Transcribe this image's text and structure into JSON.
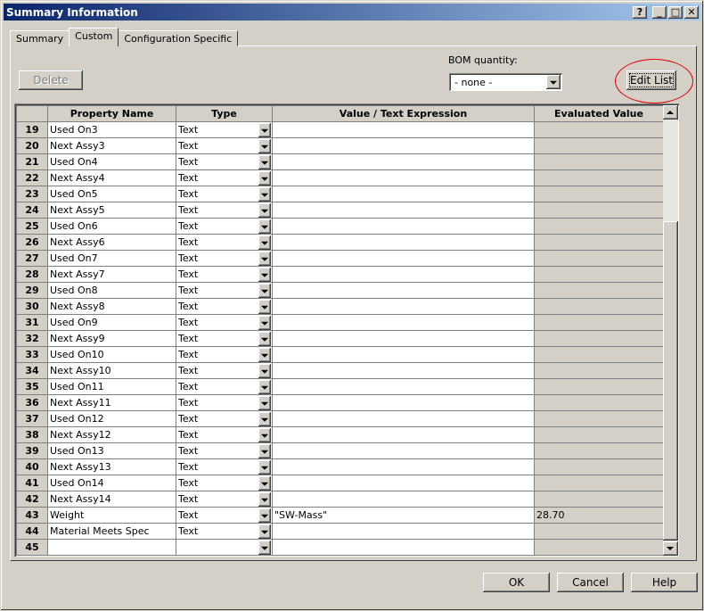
{
  "window": {
    "title": "Summary Information",
    "controls": [
      "?",
      "_",
      "□",
      "✕"
    ]
  },
  "tabs": [
    {
      "label": "Summary"
    },
    {
      "label": "Custom"
    },
    {
      "label": "Configuration Specific"
    }
  ],
  "toolbar": {
    "delete_label": "Delete",
    "bom_label": "BOM quantity:",
    "bom_value": "- none -",
    "edit_list_label": "Edit List"
  },
  "grid": {
    "headers": {
      "corner": "",
      "name": "Property Name",
      "type": "Type",
      "value": "Value / Text Expression",
      "evaluated": "Evaluated Value"
    },
    "rows": [
      {
        "num": "19",
        "name": "Used On3",
        "type": "Text",
        "value": "",
        "eval": ""
      },
      {
        "num": "20",
        "name": "Next Assy3",
        "type": "Text",
        "value": "",
        "eval": ""
      },
      {
        "num": "21",
        "name": "Used On4",
        "type": "Text",
        "value": "",
        "eval": ""
      },
      {
        "num": "22",
        "name": "Next Assy4",
        "type": "Text",
        "value": "",
        "eval": ""
      },
      {
        "num": "23",
        "name": "Used On5",
        "type": "Text",
        "value": "",
        "eval": ""
      },
      {
        "num": "24",
        "name": "Next Assy5",
        "type": "Text",
        "value": "",
        "eval": ""
      },
      {
        "num": "25",
        "name": "Used On6",
        "type": "Text",
        "value": "",
        "eval": ""
      },
      {
        "num": "26",
        "name": "Next Assy6",
        "type": "Text",
        "value": "",
        "eval": ""
      },
      {
        "num": "27",
        "name": "Used On7",
        "type": "Text",
        "value": "",
        "eval": ""
      },
      {
        "num": "28",
        "name": "Next Assy7",
        "type": "Text",
        "value": "",
        "eval": ""
      },
      {
        "num": "29",
        "name": "Used On8",
        "type": "Text",
        "value": "",
        "eval": ""
      },
      {
        "num": "30",
        "name": "Next Assy8",
        "type": "Text",
        "value": "",
        "eval": ""
      },
      {
        "num": "31",
        "name": "Used On9",
        "type": "Text",
        "value": "",
        "eval": ""
      },
      {
        "num": "32",
        "name": "Next Assy9",
        "type": "Text",
        "value": "",
        "eval": ""
      },
      {
        "num": "33",
        "name": "Used On10",
        "type": "Text",
        "value": "",
        "eval": ""
      },
      {
        "num": "34",
        "name": "Next Assy10",
        "type": "Text",
        "value": "",
        "eval": ""
      },
      {
        "num": "35",
        "name": "Used On11",
        "type": "Text",
        "value": "",
        "eval": ""
      },
      {
        "num": "36",
        "name": "Next Assy11",
        "type": "Text",
        "value": "",
        "eval": ""
      },
      {
        "num": "37",
        "name": "Used On12",
        "type": "Text",
        "value": "",
        "eval": ""
      },
      {
        "num": "38",
        "name": "Next Assy12",
        "type": "Text",
        "value": "",
        "eval": ""
      },
      {
        "num": "39",
        "name": "Used On13",
        "type": "Text",
        "value": "",
        "eval": ""
      },
      {
        "num": "40",
        "name": "Next Assy13",
        "type": "Text",
        "value": "",
        "eval": ""
      },
      {
        "num": "41",
        "name": "Used On14",
        "type": "Text",
        "value": "",
        "eval": ""
      },
      {
        "num": "42",
        "name": "Next Assy14",
        "type": "Text",
        "value": "",
        "eval": ""
      },
      {
        "num": "43",
        "name": "Weight",
        "type": "Text",
        "value": "\"SW-Mass\"",
        "eval": "28.70"
      },
      {
        "num": "44",
        "name": "Material Meets Spec",
        "type": "Text",
        "value": "",
        "eval": ""
      },
      {
        "num": "45",
        "name": "",
        "type": "",
        "value": "",
        "eval": ""
      }
    ]
  },
  "footer": {
    "ok_label": "OK",
    "cancel_label": "Cancel",
    "help_label": "Help"
  },
  "colors": {
    "title_start": "#0a246a",
    "title_end": "#a6caf0",
    "face": "#d4d0c8",
    "annotation_circle": "#e00000"
  }
}
